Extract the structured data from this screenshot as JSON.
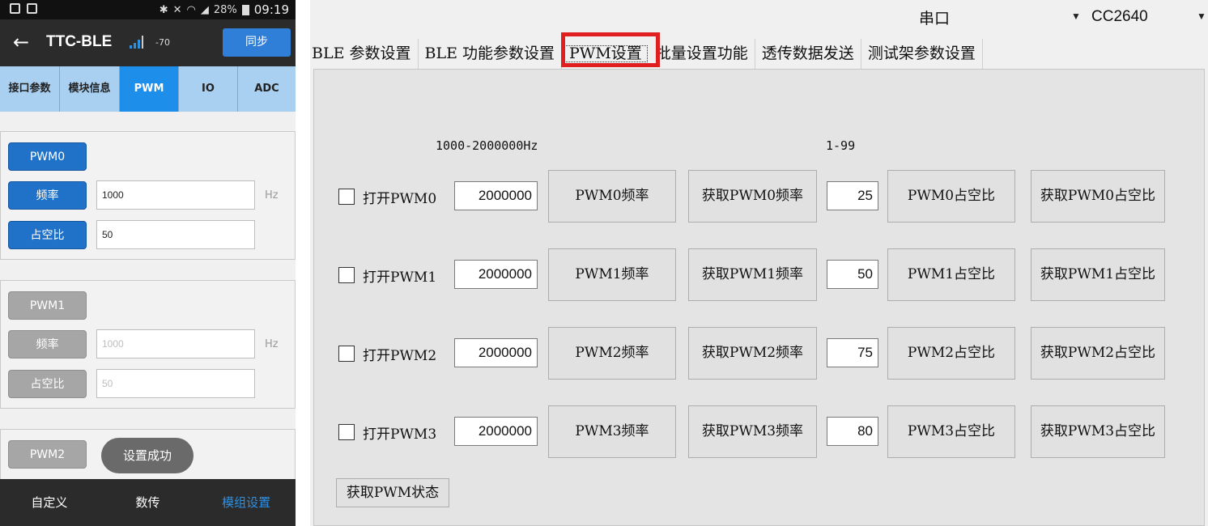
{
  "phone": {
    "status_time": "09:19",
    "battery": "28%",
    "title": "TTC-BLE",
    "rssi": "-70",
    "sync_label": "同步",
    "tabs": [
      {
        "label": "接口参数",
        "active": false
      },
      {
        "label": "模块信息",
        "active": false
      },
      {
        "label": "PWM",
        "active": true
      },
      {
        "label": "IO",
        "active": false
      },
      {
        "label": "ADC",
        "active": false
      }
    ],
    "pwm0": {
      "label": "PWM0",
      "freq_label": "频率",
      "freq_value": "1000",
      "duty_label": "占空比",
      "duty_value": "50",
      "unit": "Hz"
    },
    "pwm1": {
      "label": "PWM1",
      "freq_label": "频率",
      "freq_value": "1000",
      "duty_label": "占空比",
      "duty_value": "50",
      "unit": "Hz"
    },
    "pwm2": {
      "label": "PWM2"
    },
    "toast": "设置成功",
    "nav": [
      {
        "label": "自定义",
        "active": false
      },
      {
        "label": "数传",
        "active": false
      },
      {
        "label": "模组设置",
        "active": true
      }
    ],
    "accent": "#1d8fea"
  },
  "desktop": {
    "port_combo": "串口",
    "device_combo": "CC2640",
    "tabs": [
      "BLE 参数设置",
      "BLE 功能参数设置",
      "PWM设置",
      "批量设置功能",
      "透传数据发送",
      "测试架参数设置"
    ],
    "freq_range": "1000-2000000Hz",
    "duty_range": "1-99",
    "rows": [
      {
        "open": "打开PWM0",
        "freq": "2000000",
        "set_freq": "PWM0频率",
        "get_freq": "获取PWM0频率",
        "duty": "25",
        "set_duty": "PWM0占空比",
        "get_duty": "获取PWM0占空比"
      },
      {
        "open": "打开PWM1",
        "freq": "2000000",
        "set_freq": "PWM1频率",
        "get_freq": "获取PWM1频率",
        "duty": "50",
        "set_duty": "PWM1占空比",
        "get_duty": "获取PWM1占空比"
      },
      {
        "open": "打开PWM2",
        "freq": "2000000",
        "set_freq": "PWM2频率",
        "get_freq": "获取PWM2频率",
        "duty": "75",
        "set_duty": "PWM2占空比",
        "get_duty": "获取PWM2占空比"
      },
      {
        "open": "打开PWM3",
        "freq": "2000000",
        "set_freq": "PWM3频率",
        "get_freq": "获取PWM3频率",
        "duty": "80",
        "set_duty": "PWM3占空比",
        "get_duty": "获取PWM3占空比"
      }
    ],
    "get_status": "获取PWM状态",
    "highlight_color": "#e02020"
  }
}
